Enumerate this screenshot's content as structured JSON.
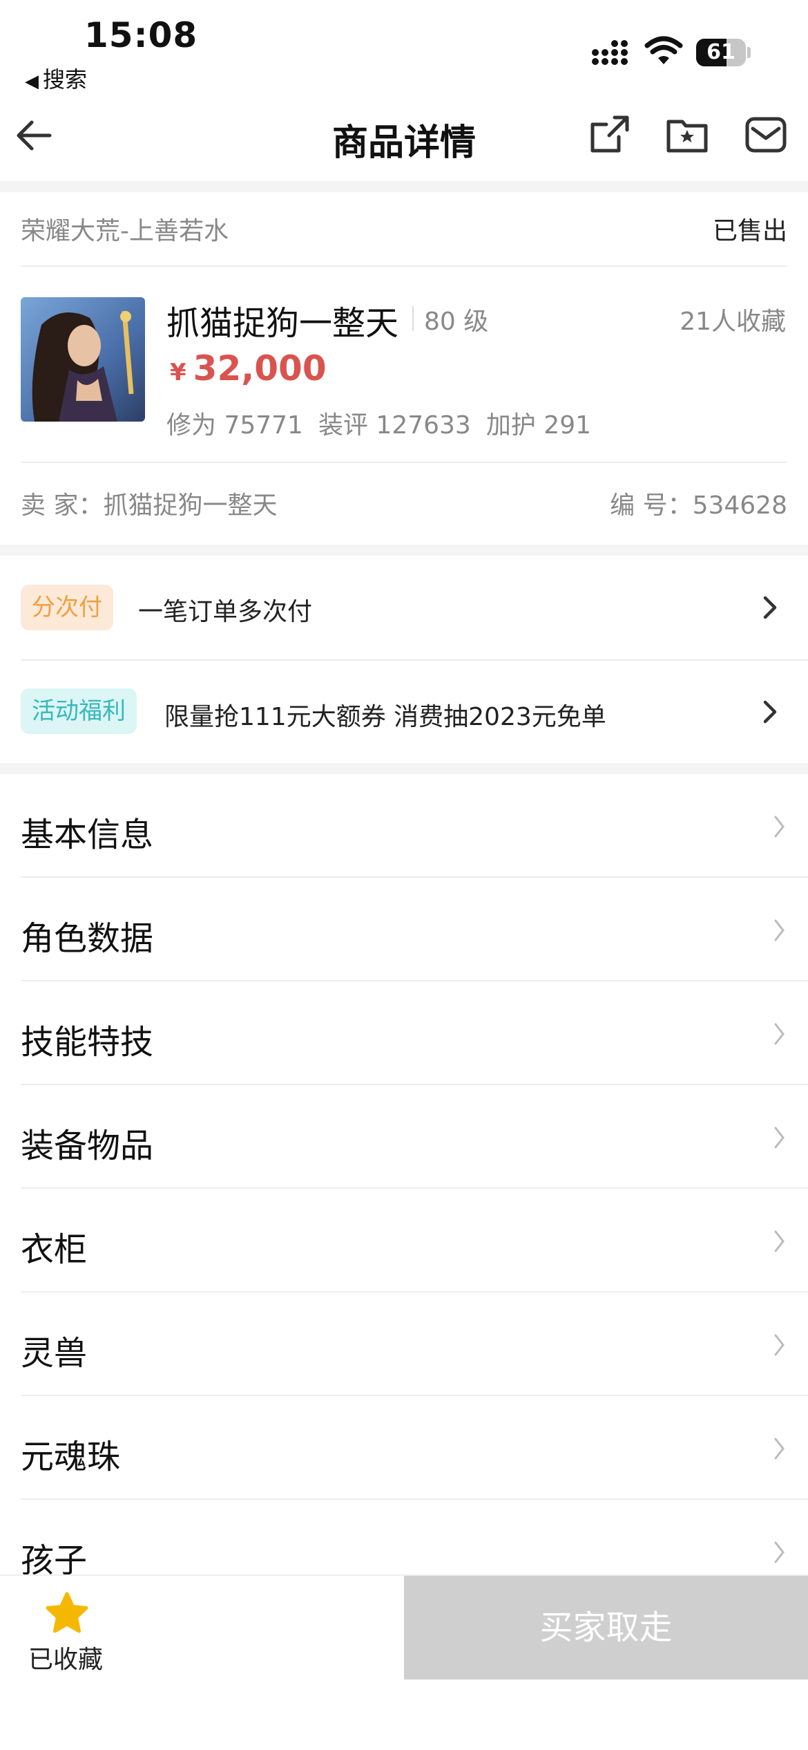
{
  "status_bar": {
    "time": "15:08",
    "back_app": "搜索",
    "battery": "61",
    "battery_level_percent": 61
  },
  "nav": {
    "title": "商品详情",
    "icons": [
      "back-arrow-icon",
      "share-icon",
      "favorite-folder-icon",
      "message-icon"
    ]
  },
  "product": {
    "server": "荣耀大荒-上善若水",
    "status": "已售出",
    "role_name": "抓猫捉狗一整天",
    "level": "80 级",
    "favorites": "21人收藏",
    "price_currency": "¥",
    "price": "32,000",
    "stats": [
      "修为 75771",
      "装评 127633",
      "加护 291"
    ],
    "seller": "卖 家：抓猫捉狗一整天",
    "serial": "编 号：534628"
  },
  "promos": [
    {
      "tag": "分次付",
      "text": "一笔订单多次付"
    },
    {
      "tag": "活动福利",
      "text": "限量抢111元大额券 消费抽2023元免单"
    }
  ],
  "menu": [
    "基本信息",
    "角色数据",
    "技能特技",
    "装备物品",
    "衣柜",
    "灵兽",
    "元魂珠",
    "孩子"
  ],
  "bottom": {
    "favorite_label": "已收藏",
    "buy_label": "买家取走"
  },
  "colors": {
    "price": "#d9534f",
    "tag_orange": "#f0a040",
    "tag_cyan": "#38b8b8",
    "star": "#f5b800",
    "disabled_button": "#cfcfcf"
  }
}
